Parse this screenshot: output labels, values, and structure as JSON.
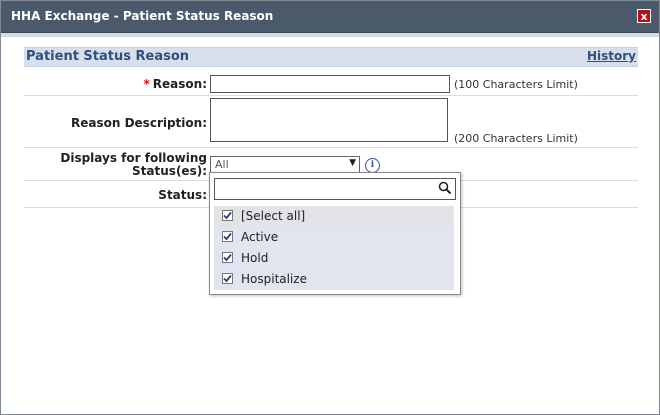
{
  "window": {
    "title": "HHA Exchange - Patient Status Reason",
    "close_label": "x"
  },
  "panel": {
    "title": "Patient Status Reason",
    "history_link": "History"
  },
  "form": {
    "reason_required": "*",
    "reason_label": "Reason:",
    "reason_value": "",
    "reason_hint": "(100 Characters Limit)",
    "description_label": "Reason Description:",
    "description_value": "",
    "description_hint": "(200 Characters Limit)",
    "statuses_label_line1": "Displays for following",
    "statuses_label_line2": "Status(es):",
    "statuses_selected": "All",
    "status_label": "Status:"
  },
  "dropdown": {
    "search_value": "",
    "items": [
      {
        "label": "[Select all]",
        "checked": true
      },
      {
        "label": "Active",
        "checked": true
      },
      {
        "label": "Hold",
        "checked": true
      },
      {
        "label": "Hospitalize",
        "checked": true
      }
    ]
  },
  "colors": {
    "titlebar": "#4a5a6a",
    "header_bg": "#d8dfec",
    "header_text": "#2f4f7f",
    "close": "#b4121a",
    "required": "#dd1111"
  }
}
